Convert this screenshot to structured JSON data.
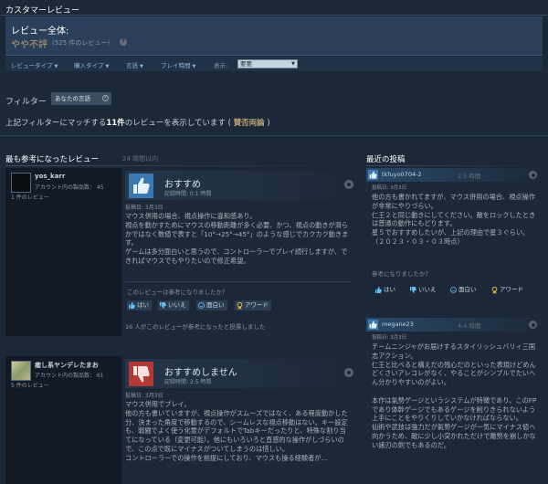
{
  "header": {
    "title": "カスタマーレビュー"
  },
  "summary": {
    "label": "レビュー全体:",
    "score": "やや不評",
    "count": "(525 件のレビュー)",
    "help_icon": "?"
  },
  "filter_bar": {
    "items": [
      "レビュータイプ",
      "購入タイプ",
      "言語",
      "プレイ時間"
    ],
    "show_label": "表示:",
    "select_value": "要要"
  },
  "filters": {
    "label": "フィルター",
    "chip": "あなたの言語",
    "chip_close": "×",
    "match_prefix": "上記フィルターにマッチする",
    "match_count": "11件",
    "match_mid": "のレビューを表示しています (",
    "match_rating": "賛否両論",
    "match_suffix": ")"
  },
  "sections": {
    "helpful_title": "最も参考になったレビュー",
    "helpful_sub": "24 時間以内",
    "recent_title": "最近の投稿"
  },
  "reviews": [
    {
      "author": "yos_karr",
      "games": "アカウント内の製品数： 45",
      "review_count": "1 件のレビュー",
      "recommendation": "おすすめ",
      "hours": "記録時間: 0.1 時間",
      "posted": "投稿日: 3月3日",
      "text": "マウス併用の場合、視点操作に違和感あり。\n視点を動かすためにマウスの移動距離が多く必要、かつ、視点の動きが滑らかではなく数値で表すと「10°→25°→45°」のような感じでカクカク動きます。\nゲームは多分面白いと思うので、コントローラーでプレイ続行しますが、できればマウスでもやりたいので修正希望。",
      "helpful_q": "このレビューは参考になりましたか？",
      "yes": "はい",
      "no": "いいえ",
      "funny": "面白い",
      "award": "アワード",
      "found_helpful": "16 人がこのレビューが参考になったと投票しました"
    },
    {
      "author": "癒し系ヤンデレたまお",
      "games": "アカウント内の製品数： 61",
      "review_count": "5 件のレビュー",
      "recommendation": "おすすめしません",
      "hours": "記録時間: 2.5 時間",
      "posted": "投稿日: 3月3日",
      "text": "マウス併用でプレイ。\n他の方も書いていますが、視点操作がスムーズではなく、ある程度動かした分、決まった角度で移動するので、シームレスな視点移動はない。キー設定も、戦闘でよく使う化霊がデフォルトでTabキーだったりと、特殊な割り当てになっている（変更可能）。他にもいろいろと直感的な操作がしづらいので、この点で既にマイナスがついてしまうのは惜しい。\nコントローラーでの操作を前提にしており、マウスも操る経験者が..."
    }
  ],
  "recent": [
    {
      "user": "tkfuyo0704-2",
      "hours": "2.5 時間",
      "posted": "投稿日: 3月3日",
      "text": "他の方も書かれてますが、マウス併用の場合、視点操作が非常にやりづらい。\n仁王２と同じ動きにしてください。敵をロックしたときは普通の動作にもどります。\n星５でおすすめしたいが、上記の理由で星３ぐらい。（２０２３・０３・０３時点）",
      "helpful_q": "参考になりましたか？",
      "yes": "はい",
      "no": "いいえ",
      "funny": "面白い",
      "award": "アワード"
    },
    {
      "user": "megane23",
      "hours": "4.4 時間",
      "posted": "投稿日: 3月3日",
      "text": "チームニンジャがお届けするスタイリッシュバリィ三国志アクション。\n仁王と比べると構えだの残心だのといった表現けどめんどくさいアレコレがなく、やることがシンプルでたいへん分かりやすいのがよい。\n\n本作は氣勢ゲージというシステムが特徴であり、このFPであり体幹ゲージでもあるゲージを削りきられないよう上手にことをやりくりしていかなければならない。\n仙術や武技は強力だが氣勢ゲージが一気にマイナス値へ向かうため、敵に少し小突かれただけで離勢を崩しかない諸刃の剣でもあるのだ。"
    }
  ],
  "colors": {
    "background": "#1b2838",
    "positive": "#66c0f4",
    "negative": "#c9362f",
    "mixed": "#b9a074"
  }
}
